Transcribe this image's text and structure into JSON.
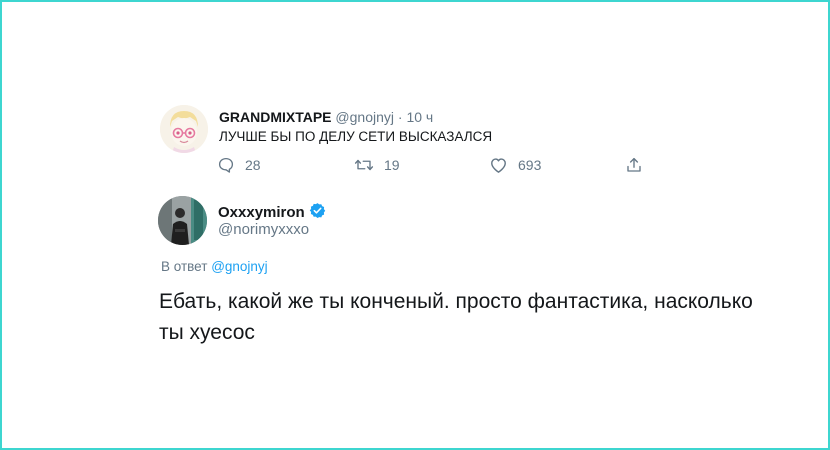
{
  "reply_tweet": {
    "display_name": "GRANDMIXTAPE",
    "handle": "@gnojnyj",
    "separator": "·",
    "time": "10 ч",
    "text": "ЛУЧШЕ БЫ ПО ДЕЛУ СЕТИ ВЫСКАЗАЛСЯ",
    "actions": {
      "reply_icon": "reply-bubble-icon",
      "reply_count": "28",
      "retweet_icon": "retweet-icon",
      "retweet_count": "19",
      "like_icon": "heart-icon",
      "like_count": "693",
      "share_icon": "share-icon"
    }
  },
  "main_tweet": {
    "display_name": "Oxxxymiron",
    "verified_icon": "verified-badge-icon",
    "handle": "@norimyxxxo",
    "reply_prefix": "В ответ",
    "reply_to": "@gnojnyj",
    "text": "Ебать, какой же ты конченый. просто фантастика, насколько ты хуесос"
  },
  "colors": {
    "frame_border": "#3dd6d0",
    "link": "#1da1f2",
    "secondary_text": "#657786",
    "primary_text": "#14171a"
  }
}
